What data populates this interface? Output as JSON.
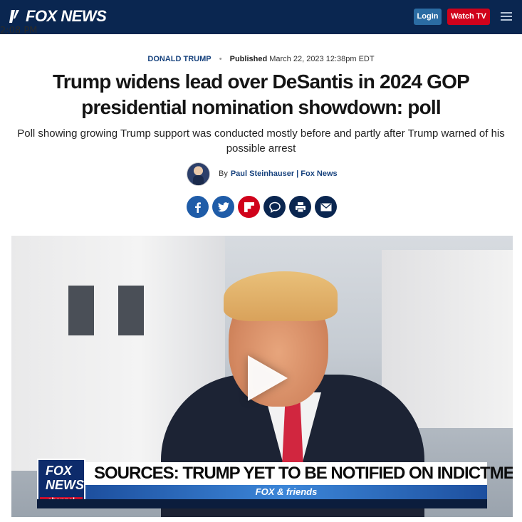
{
  "header": {
    "logo_text": "FOX NEWS",
    "clock": "2:08 PM",
    "login_label": "Login",
    "watch_label": "Watch TV",
    "colors": {
      "bar": "#0a2650",
      "login": "#2b6ca3",
      "watch": "#d0021b"
    }
  },
  "article": {
    "category": "DONALD TRUMP",
    "published_label": "Published",
    "published_date": "March 22, 2023 12:38pm EDT",
    "headline": "Trump widens lead over DeSantis in 2024 GOP presidential nomination showdown: poll",
    "subhead": "Poll showing growing Trump support was conducted mostly before and partly after Trump warned of his possible arrest",
    "byline_prefix": "By",
    "author": "Paul Steinhauser | Fox News"
  },
  "share": [
    {
      "icon": "facebook-icon",
      "color": "#1f5ca8"
    },
    {
      "icon": "twitter-icon",
      "color": "#1f5ca8"
    },
    {
      "icon": "flipboard-icon",
      "color": "#d0021b"
    },
    {
      "icon": "comments-icon",
      "color": "#0a2650"
    },
    {
      "icon": "print-icon",
      "color": "#0a2650"
    },
    {
      "icon": "email-icon",
      "color": "#0a2650"
    }
  ],
  "video": {
    "lower_third_logo_top": "FOX",
    "lower_third_logo_bottom": "NEWS",
    "lower_third_channel": "channel",
    "headline": "SOURCES: TRUMP YET TO BE NOTIFIED ON INDICTMENT",
    "show": "FOX & friends"
  }
}
